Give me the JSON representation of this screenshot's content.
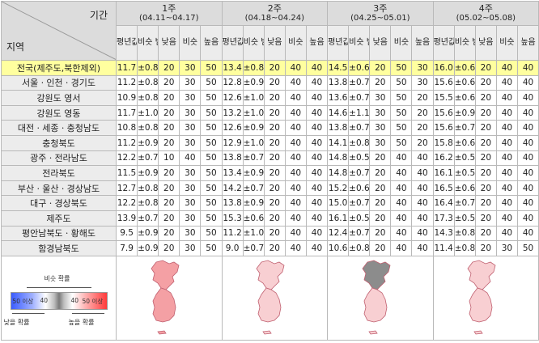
{
  "header": {
    "period_label": "기간",
    "region_label": "지역",
    "weeks": [
      {
        "label": "1주",
        "dates": "(04.11~04.17)"
      },
      {
        "label": "2주",
        "dates": "(04.18~04.24)"
      },
      {
        "label": "3주",
        "dates": "(04.25~05.01)"
      },
      {
        "label": "4주",
        "dates": "(05.02~05.08)"
      }
    ],
    "subcols": [
      "평년값 (℃)",
      "비슷 범위 (℃)",
      "낮음",
      "비슷",
      "높음"
    ]
  },
  "rows": [
    {
      "region": "전국(제주도,북한제외)",
      "weeks": [
        [
          "11.7",
          "±0.8",
          "20",
          "30",
          "50"
        ],
        [
          "13.4",
          "±0.8",
          "20",
          "40",
          "40"
        ],
        [
          "14.5",
          "±0.6",
          "20",
          "50",
          "30"
        ],
        [
          "16.0",
          "±0.6",
          "20",
          "40",
          "40"
        ]
      ]
    },
    {
      "region": "서울ㆍ인천ㆍ경기도",
      "weeks": [
        [
          "11.2",
          "±0.8",
          "20",
          "30",
          "50"
        ],
        [
          "12.8",
          "±0.9",
          "20",
          "40",
          "40"
        ],
        [
          "13.8",
          "±0.7",
          "20",
          "50",
          "30"
        ],
        [
          "15.6",
          "±0.6",
          "20",
          "40",
          "40"
        ]
      ]
    },
    {
      "region": "강원도 영서",
      "weeks": [
        [
          "10.9",
          "±0.8",
          "20",
          "30",
          "50"
        ],
        [
          "12.6",
          "±1.0",
          "20",
          "40",
          "40"
        ],
        [
          "13.6",
          "±0.7",
          "30",
          "50",
          "20"
        ],
        [
          "15.5",
          "±0.6",
          "20",
          "40",
          "40"
        ]
      ]
    },
    {
      "region": "강원도 영동",
      "weeks": [
        [
          "11.7",
          "±1.0",
          "20",
          "30",
          "50"
        ],
        [
          "13.2",
          "±1.0",
          "20",
          "40",
          "40"
        ],
        [
          "14.6",
          "±1.1",
          "30",
          "50",
          "20"
        ],
        [
          "15.6",
          "±0.9",
          "20",
          "40",
          "40"
        ]
      ]
    },
    {
      "region": "대전ㆍ세종ㆍ충청남도",
      "weeks": [
        [
          "10.8",
          "±0.8",
          "20",
          "30",
          "50"
        ],
        [
          "12.6",
          "±0.9",
          "20",
          "40",
          "40"
        ],
        [
          "13.8",
          "±0.7",
          "30",
          "50",
          "20"
        ],
        [
          "15.6",
          "±0.7",
          "20",
          "40",
          "40"
        ]
      ]
    },
    {
      "region": "충청북도",
      "weeks": [
        [
          "11.2",
          "±0.9",
          "20",
          "30",
          "50"
        ],
        [
          "12.9",
          "±1.0",
          "20",
          "40",
          "40"
        ],
        [
          "14.1",
          "±0.8",
          "30",
          "50",
          "20"
        ],
        [
          "15.8",
          "±0.6",
          "20",
          "40",
          "40"
        ]
      ]
    },
    {
      "region": "광주ㆍ전라남도",
      "weeks": [
        [
          "12.2",
          "±0.7",
          "10",
          "40",
          "50"
        ],
        [
          "13.8",
          "±0.7",
          "20",
          "40",
          "40"
        ],
        [
          "14.8",
          "±0.5",
          "20",
          "40",
          "40"
        ],
        [
          "16.2",
          "±0.5",
          "20",
          "40",
          "40"
        ]
      ]
    },
    {
      "region": "전라북도",
      "weeks": [
        [
          "11.5",
          "±0.9",
          "20",
          "30",
          "50"
        ],
        [
          "13.4",
          "±0.9",
          "20",
          "40",
          "40"
        ],
        [
          "14.8",
          "±0.7",
          "20",
          "40",
          "40"
        ],
        [
          "16.1",
          "±0.5",
          "20",
          "40",
          "40"
        ]
      ]
    },
    {
      "region": "부산ㆍ울산ㆍ경상남도",
      "weeks": [
        [
          "12.7",
          "±0.8",
          "20",
          "30",
          "50"
        ],
        [
          "14.2",
          "±0.7",
          "20",
          "40",
          "40"
        ],
        [
          "15.2",
          "±0.6",
          "20",
          "40",
          "40"
        ],
        [
          "16.5",
          "±0.6",
          "20",
          "40",
          "40"
        ]
      ]
    },
    {
      "region": "대구ㆍ경상북도",
      "weeks": [
        [
          "12.2",
          "±0.8",
          "20",
          "30",
          "50"
        ],
        [
          "13.8",
          "±0.9",
          "20",
          "40",
          "40"
        ],
        [
          "15.0",
          "±0.7",
          "20",
          "40",
          "40"
        ],
        [
          "16.4",
          "±0.7",
          "20",
          "40",
          "40"
        ]
      ]
    },
    {
      "region": "제주도",
      "weeks": [
        [
          "13.9",
          "±0.7",
          "20",
          "30",
          "50"
        ],
        [
          "15.3",
          "±0.6",
          "20",
          "40",
          "40"
        ],
        [
          "16.1",
          "±0.5",
          "20",
          "40",
          "40"
        ],
        [
          "17.3",
          "±0.5",
          "20",
          "40",
          "40"
        ]
      ]
    },
    {
      "region": "평안남북도ㆍ황해도",
      "weeks": [
        [
          "9.5",
          "±0.9",
          "20",
          "30",
          "50"
        ],
        [
          "11.2",
          "±1.0",
          "20",
          "40",
          "40"
        ],
        [
          "12.4",
          "±0.7",
          "20",
          "40",
          "40"
        ],
        [
          "14.3",
          "±0.8",
          "20",
          "40",
          "40"
        ]
      ]
    },
    {
      "region": "함경남북도",
      "weeks": [
        [
          "7.9",
          "±0.9",
          "20",
          "30",
          "50"
        ],
        [
          "9.0",
          "±0.7",
          "20",
          "40",
          "40"
        ],
        [
          "10.6",
          "±0.8",
          "20",
          "40",
          "40"
        ],
        [
          "11.4",
          "±0.8",
          "20",
          "30",
          "50"
        ]
      ]
    }
  ],
  "legend": {
    "title": "비슷 확률",
    "low_label": "낮을 확률",
    "high_label": "높을 확률",
    "ticks": [
      "50 이상",
      "40",
      "40",
      "50 이상"
    ]
  },
  "maps": {
    "colors": {
      "high50": "#f4a0a4",
      "high40": "#f8cfd2",
      "similar50": "#8c8c8c",
      "outline": "#c06070"
    },
    "weeks": [
      {
        "north": "high50",
        "south": "high50"
      },
      {
        "north": "high40",
        "south": "high40"
      },
      {
        "north": "similar50",
        "south": "high40"
      },
      {
        "north": "high40",
        "south": "high40"
      }
    ]
  }
}
